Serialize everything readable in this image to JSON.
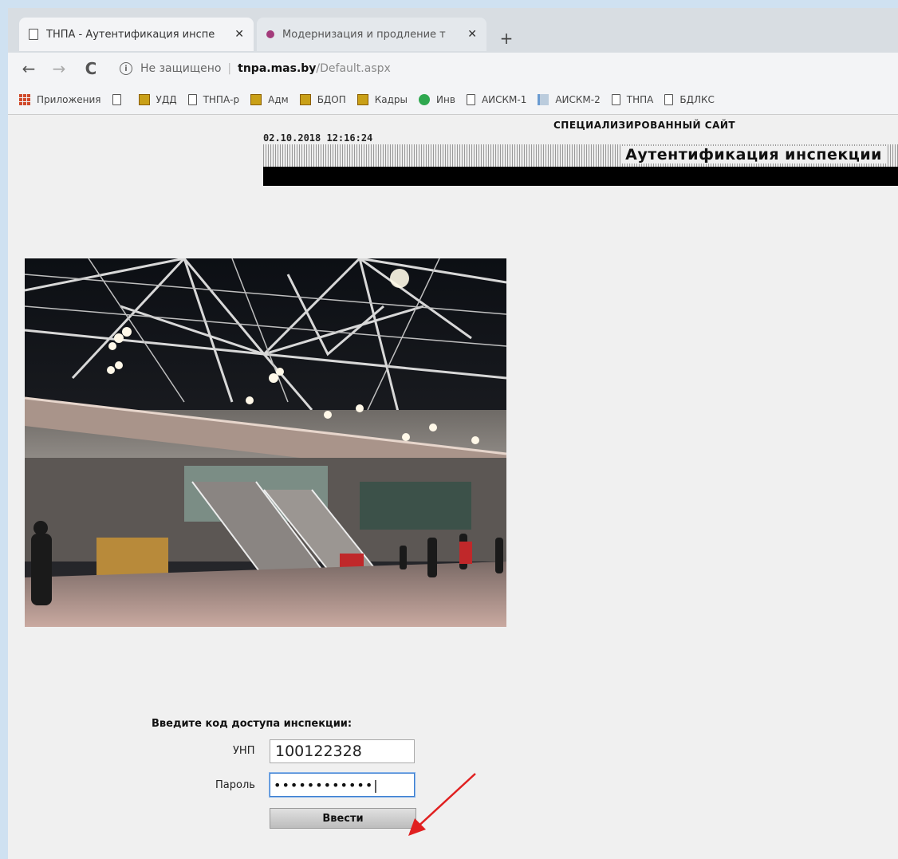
{
  "browser": {
    "tabs": [
      {
        "label": "ТНПА - Аутентификация инспе",
        "close": "✕"
      },
      {
        "label": "Модернизация и продление т",
        "close": "✕"
      }
    ],
    "new_tab": "+",
    "nav": {
      "back": "←",
      "forward": "→",
      "reload": "C"
    },
    "address": {
      "info": "i",
      "security": "Не защищено",
      "host": "tnpa.mas.by",
      "path": "/Default.aspx"
    },
    "bookmarks": [
      {
        "label": "Приложения",
        "icon": "apps-icon"
      },
      {
        "label": "",
        "icon": "page-icon"
      },
      {
        "label": "УДД",
        "icon": "emblem-icon"
      },
      {
        "label": "ТНПА-р",
        "icon": "page-icon"
      },
      {
        "label": "Адм",
        "icon": "emblem-icon"
      },
      {
        "label": "БДОП",
        "icon": "emblem-icon"
      },
      {
        "label": "Кадры",
        "icon": "emblem-icon"
      },
      {
        "label": "Инв",
        "icon": "globe-icon"
      },
      {
        "label": "АИСКМ-1",
        "icon": "page-icon"
      },
      {
        "label": "АИСКМ-2",
        "icon": "bar-icon"
      },
      {
        "label": "ТНПА",
        "icon": "page-icon"
      },
      {
        "label": "БДЛКС",
        "icon": "page-icon"
      }
    ]
  },
  "page": {
    "site_title": "СПЕЦИАЛИЗИРОВАННЫЙ САЙТ",
    "datetime": "02.10.2018 12:16:24",
    "header": "Аутентификация инспекции",
    "form": {
      "heading": "Введите код доступа инспекции:",
      "unp_label": "УНП",
      "unp_value": "100122328",
      "password_label": "Пароль",
      "password_value": "••••••••••••|",
      "submit_label": "Ввести"
    }
  },
  "colors": {
    "annotation_arrow": "#e02020",
    "header_bar": "#000000",
    "frame": "#cfe1f1"
  }
}
